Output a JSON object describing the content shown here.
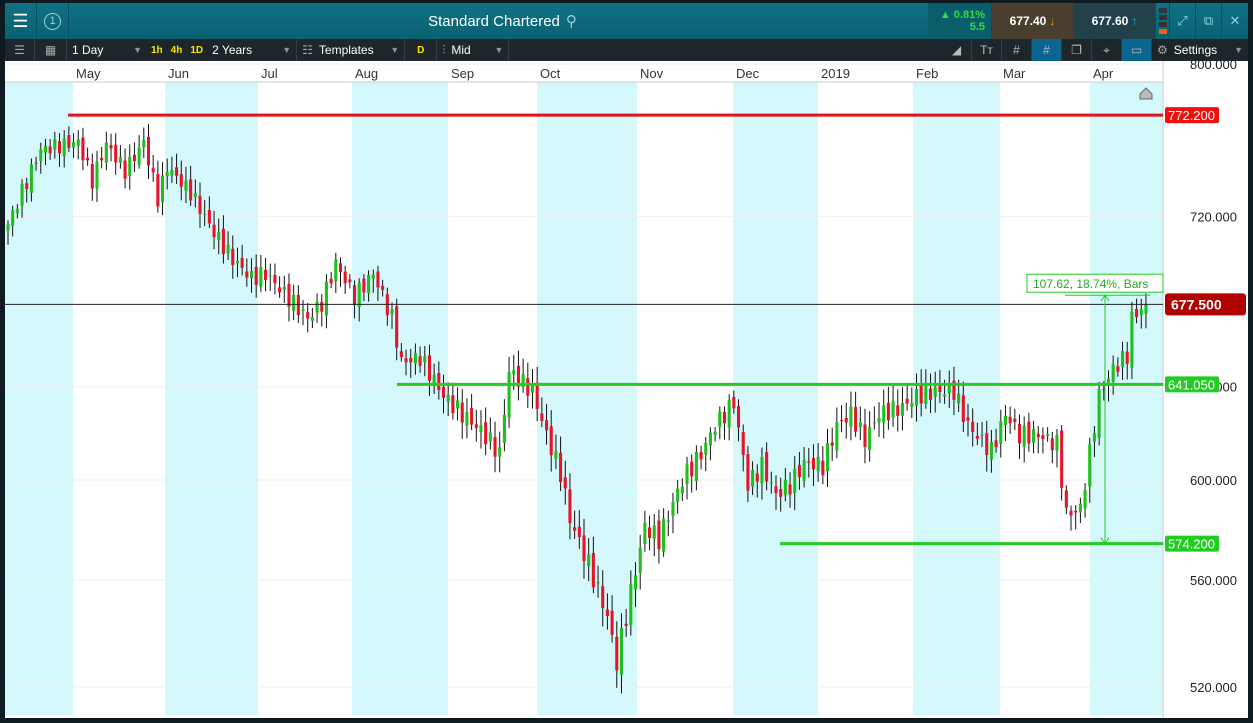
{
  "header": {
    "title": "Standard Chartered",
    "badge": "1",
    "change_pct": "▲ 0.81%",
    "change_abs": "5.5",
    "bid": "677.40",
    "ask": "677.60"
  },
  "toolbar": {
    "interval": "1 Day",
    "quick": [
      "1h",
      "4h",
      "1D"
    ],
    "range": "2 Years",
    "templates": "Templates",
    "d_label": "D",
    "price_type": "Mid",
    "settings": "Settings"
  },
  "colors": {
    "up": "#1fbf1f",
    "down": "#e3152b",
    "red_line": "#e3131b",
    "green_line": "#22cc22",
    "shade": "#d4f8fb"
  },
  "chart_data": {
    "type": "candlestick",
    "instrument": "Standard Chartered",
    "interval": "1 Day",
    "x_months": [
      "May",
      "Jun",
      "Jul",
      "Aug",
      "Sep",
      "Oct",
      "Nov",
      "Dec",
      "2019",
      "Feb",
      "Mar",
      "Apr"
    ],
    "y_ticks": [
      800,
      720,
      640,
      600,
      560,
      520
    ],
    "y_tick_labels": [
      "800.000",
      "720.000",
      "640.000",
      "600.000",
      "560.000",
      "520.000"
    ],
    "ylim": [
      520,
      800
    ],
    "scale": "log",
    "close_anchors": [
      [
        0,
        716
      ],
      [
        7,
        754
      ],
      [
        15,
        758
      ],
      [
        18,
        738
      ],
      [
        21,
        757
      ],
      [
        25,
        743
      ],
      [
        29,
        758
      ],
      [
        32,
        729
      ],
      [
        34,
        745
      ],
      [
        39,
        732
      ],
      [
        44,
        712
      ],
      [
        48,
        699
      ],
      [
        52,
        690
      ],
      [
        55,
        692
      ],
      [
        61,
        678
      ],
      [
        64,
        671
      ],
      [
        67,
        678
      ],
      [
        70,
        697
      ],
      [
        74,
        681
      ],
      [
        78,
        692
      ],
      [
        82,
        671
      ],
      [
        84,
        651
      ],
      [
        88,
        653
      ],
      [
        93,
        636
      ],
      [
        97,
        628
      ],
      [
        101,
        621
      ],
      [
        105,
        611
      ],
      [
        107,
        647
      ],
      [
        112,
        638
      ],
      [
        115,
        619
      ],
      [
        118,
        603
      ],
      [
        120,
        584
      ],
      [
        124,
        566
      ],
      [
        128,
        546
      ],
      [
        130,
        529
      ],
      [
        133,
        555
      ],
      [
        136,
        581
      ],
      [
        139,
        576
      ],
      [
        144,
        600
      ],
      [
        148,
        611
      ],
      [
        151,
        623
      ],
      [
        155,
        633
      ],
      [
        158,
        598
      ],
      [
        161,
        606
      ],
      [
        164,
        594
      ],
      [
        167,
        598
      ],
      [
        170,
        607
      ],
      [
        174,
        606
      ],
      [
        177,
        623
      ],
      [
        180,
        628
      ],
      [
        183,
        617
      ],
      [
        186,
        628
      ],
      [
        191,
        631
      ],
      [
        194,
        636
      ],
      [
        198,
        638
      ],
      [
        202,
        638
      ],
      [
        205,
        623
      ],
      [
        210,
        612
      ],
      [
        213,
        628
      ],
      [
        216,
        619
      ],
      [
        220,
        619
      ],
      [
        224,
        615
      ],
      [
        226,
        586
      ],
      [
        229,
        588
      ],
      [
        231,
        611
      ],
      [
        233,
        636
      ],
      [
        236,
        648
      ],
      [
        239,
        654
      ],
      [
        240,
        671
      ],
      [
        243,
        677.5
      ]
    ],
    "total_bars": 246,
    "levels": [
      {
        "label": "772.200",
        "value": 772.2,
        "color": "red"
      },
      {
        "label": "641.050",
        "value": 641.05,
        "color": "green"
      },
      {
        "label": "574.200",
        "value": 574.2,
        "color": "green"
      }
    ],
    "current_price": {
      "label": "677.500",
      "value": 677.5
    },
    "measure": {
      "label": "107.62, 18.74%, Bars",
      "from": 574.2,
      "to": 681.8
    }
  }
}
